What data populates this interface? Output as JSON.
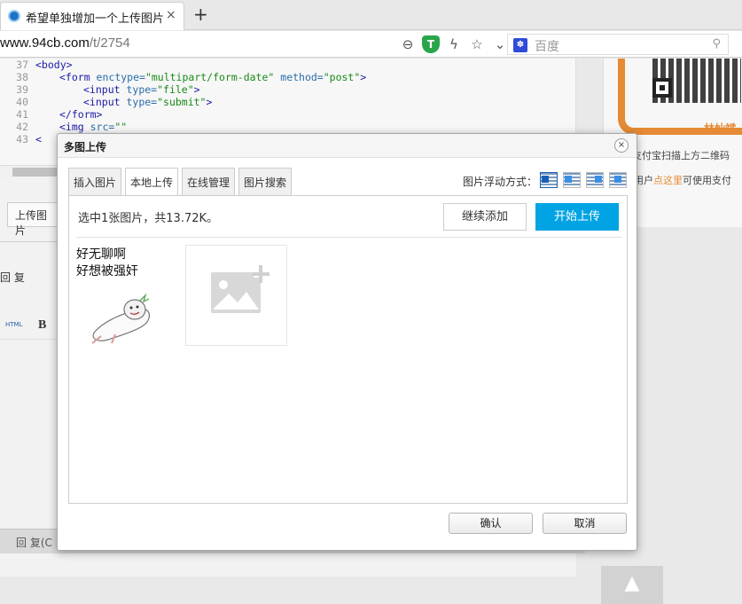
{
  "browser": {
    "tab_title": "希望单独增加一个上传图片的",
    "url_host": "www.94cb.com",
    "url_path": "/t/2754",
    "search_placeholder": "百度"
  },
  "code_editor": {
    "lines": [
      {
        "num": "37",
        "indent": 0,
        "parts": [
          {
            "t": "tag",
            "v": "<body>"
          }
        ]
      },
      {
        "num": "38",
        "indent": 1,
        "parts": [
          {
            "t": "tag",
            "v": "<form "
          },
          {
            "t": "attr",
            "v": "enctype="
          },
          {
            "t": "str",
            "v": "\"multipart/form-date\""
          },
          {
            "t": "attr",
            "v": " method="
          },
          {
            "t": "str",
            "v": "\"post\""
          },
          {
            "t": "tag",
            "v": ">"
          }
        ]
      },
      {
        "num": "39",
        "indent": 2,
        "parts": [
          {
            "t": "tag",
            "v": "<input "
          },
          {
            "t": "attr",
            "v": "type="
          },
          {
            "t": "str",
            "v": "\"file\""
          },
          {
            "t": "tag",
            "v": ">"
          }
        ]
      },
      {
        "num": "40",
        "indent": 2,
        "parts": [
          {
            "t": "tag",
            "v": "<input "
          },
          {
            "t": "attr",
            "v": "type="
          },
          {
            "t": "str",
            "v": "\"submit\""
          },
          {
            "t": "tag",
            "v": ">"
          }
        ]
      },
      {
        "num": "41",
        "indent": 1,
        "parts": [
          {
            "t": "tag",
            "v": "</form>"
          }
        ]
      },
      {
        "num": "42",
        "indent": 1,
        "parts": [
          {
            "t": "tag",
            "v": "<img "
          },
          {
            "t": "attr",
            "v": "src="
          },
          {
            "t": "str",
            "v": "\"\""
          }
        ]
      },
      {
        "num": "43",
        "indent": 0,
        "parts": [
          {
            "t": "tag",
            "v": "<"
          }
        ]
      }
    ]
  },
  "background_page": {
    "upload_image_button": "上传图片",
    "reply_label": "回 复",
    "html_label": "HTML",
    "bold_label": "B",
    "footer_reply": "回 复(C"
  },
  "sidebar": {
    "name": "林灿斌",
    "line1": "支付宝扫描上方二维码",
    "line2_prefix": "用户",
    "line2_highlight": "点这里",
    "line2_suffix": "可使用支付"
  },
  "back_to_top": "▲",
  "dialog": {
    "title": "多图上传",
    "close": "×",
    "tabs": [
      "插入图片",
      "本地上传",
      "在线管理",
      "图片搜索"
    ],
    "active_tab": 1,
    "float_label": "图片浮动方式：",
    "status": "选中1张图片，共13.72K。",
    "continue_add": "继续添加",
    "start_upload": "开始上传",
    "meme_text": [
      "好无聊啊",
      "好想被强奸"
    ],
    "confirm": "确认",
    "cancel": "取消"
  },
  "colors": {
    "primary_blue": "#00a4e4",
    "accent_orange": "#e58a35"
  }
}
